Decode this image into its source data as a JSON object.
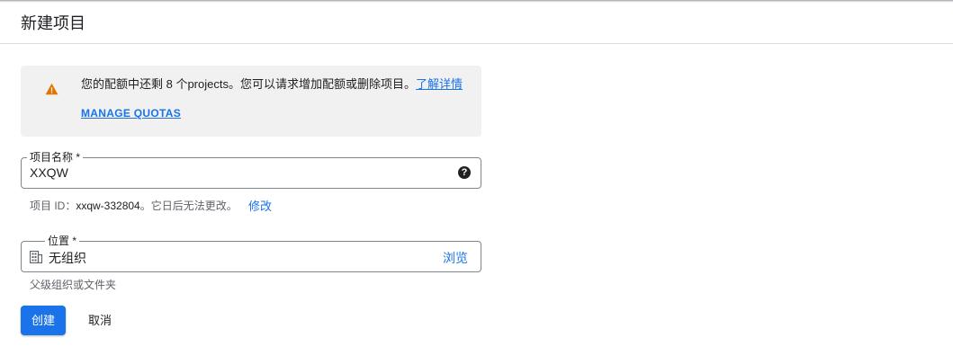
{
  "page": {
    "title": "新建项目"
  },
  "notice": {
    "text": "您的配额中还剩 8 个projects。您可以请求增加配额或删除项目。",
    "learn_more": "了解详情",
    "manage_quotas": "MANAGE QUOTAS",
    "icon": "warning-icon"
  },
  "project_name": {
    "label": "项目名称 *",
    "value": "XXQW",
    "help_icon": "?"
  },
  "project_id": {
    "prefix": "项目 ID：",
    "value": "xxqw-332804",
    "suffix": "。它日后无法更改。",
    "edit": "修改"
  },
  "location": {
    "label": "位置 *",
    "value": "无组织",
    "browse": "浏览",
    "hint": "父级组织或文件夹",
    "icon": "organization-icon"
  },
  "actions": {
    "create": "创建",
    "cancel": "取消"
  },
  "colors": {
    "accent": "#1a73e8",
    "warning": "#e37400",
    "notice_bg": "#f1f1f1"
  }
}
